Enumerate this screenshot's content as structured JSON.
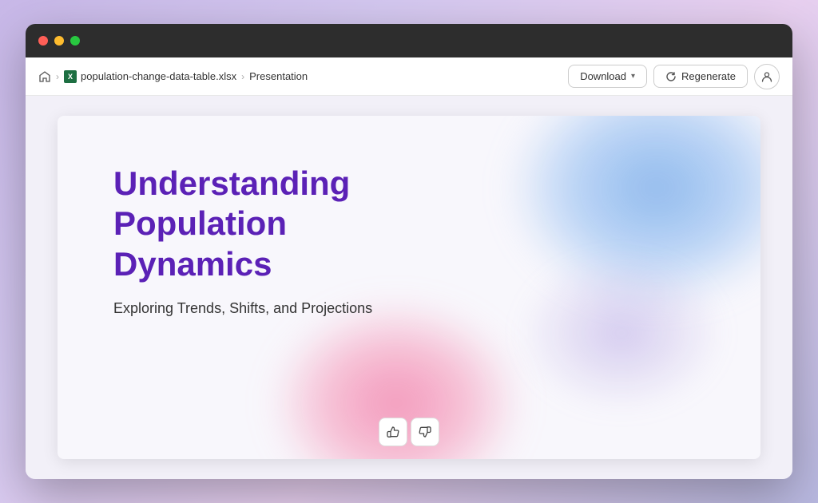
{
  "browser": {
    "traffic_lights": [
      "red",
      "yellow",
      "green"
    ]
  },
  "toolbar": {
    "breadcrumb": {
      "home_label": "Home",
      "separator1": "›",
      "file_name": "population-change-data-table.xlsx",
      "separator2": "›",
      "current_page": "Presentation"
    },
    "download_label": "Download",
    "regenerate_label": "Regenerate",
    "chevron": "▾"
  },
  "slide": {
    "title": "Understanding Population Dynamics",
    "subtitle": "Exploring Trends, Shifts, and Projections"
  },
  "feedback": {
    "thumbs_up": "👍",
    "thumbs_down": "👎"
  }
}
